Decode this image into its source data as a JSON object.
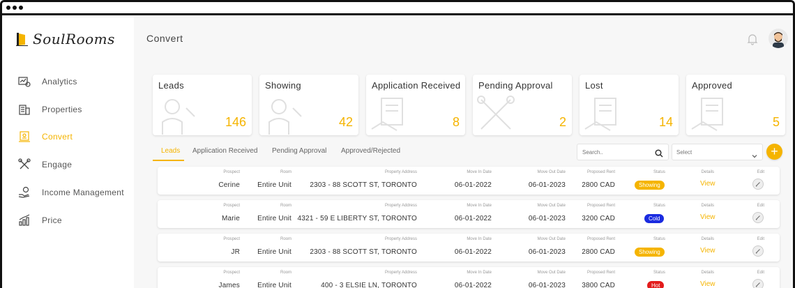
{
  "app": {
    "logo_text": "SoulRooms",
    "page_title": "Convert"
  },
  "sidebar": {
    "items": [
      {
        "label": "Analytics",
        "icon": "analytics-icon",
        "active": false
      },
      {
        "label": "Properties",
        "icon": "building-icon",
        "active": false
      },
      {
        "label": "Convert",
        "icon": "convert-icon",
        "active": true
      },
      {
        "label": "Engage",
        "icon": "tools-icon",
        "active": false
      },
      {
        "label": "Income Management",
        "icon": "hand-money-icon",
        "active": false
      },
      {
        "label": "Price",
        "icon": "price-chart-icon",
        "active": false
      }
    ]
  },
  "cards": [
    {
      "title": "Leads",
      "value": "146"
    },
    {
      "title": "Showing",
      "value": "42"
    },
    {
      "title": "Application Received",
      "value": "8"
    },
    {
      "title": "Pending Approval",
      "value": "2"
    },
    {
      "title": "Lost",
      "value": "14"
    },
    {
      "title": "Approved",
      "value": "5"
    }
  ],
  "tabs": [
    {
      "label": "Leads",
      "active": true
    },
    {
      "label": "Application Received",
      "active": false
    },
    {
      "label": "Pending Approval",
      "active": false
    },
    {
      "label": "Approved/Rejected",
      "active": false
    }
  ],
  "toolbar": {
    "search_placeholder": "Search..",
    "select_label": "Select",
    "add_label": "+"
  },
  "table": {
    "headers": {
      "prospect": "Prospect",
      "room": "Room",
      "address": "Property Address",
      "move_in": "Move In Date",
      "move_out": "Move Out Date",
      "rent": "Proposed Rent",
      "status": "Status",
      "details": "Details",
      "edit": "Edit"
    },
    "rows": [
      {
        "prospect": "Cerine",
        "room": "Entire Unit",
        "address": "2303 - 88 SCOTT ST, TORONTO",
        "move_in": "06-01-2022",
        "move_out": "06-01-2023",
        "rent": "2800 CAD",
        "status": "Showing",
        "status_color": "#f5b400",
        "details": "View"
      },
      {
        "prospect": "Marie",
        "room": "Entire Unit",
        "address": "4321 - 59 E LIBERTY ST, TORONTO",
        "move_in": "06-01-2022",
        "move_out": "06-01-2023",
        "rent": "3200 CAD",
        "status": "Cold",
        "status_color": "#1a2be0",
        "details": "View"
      },
      {
        "prospect": "JR",
        "room": "Entire Unit",
        "address": "2303 - 88 SCOTT ST, TORONTO",
        "move_in": "06-01-2022",
        "move_out": "06-01-2023",
        "rent": "2800 CAD",
        "status": "Showing",
        "status_color": "#f5b400",
        "details": "View"
      },
      {
        "prospect": "James",
        "room": "Entire Unit",
        "address": "400 - 3 ELSIE LN, TORONTO",
        "move_in": "06-01-2022",
        "move_out": "06-01-2023",
        "rent": "3800 CAD",
        "status": "Hot",
        "status_color": "#e31b1b",
        "details": "View"
      }
    ]
  },
  "colors": {
    "accent": "#f5b400"
  }
}
